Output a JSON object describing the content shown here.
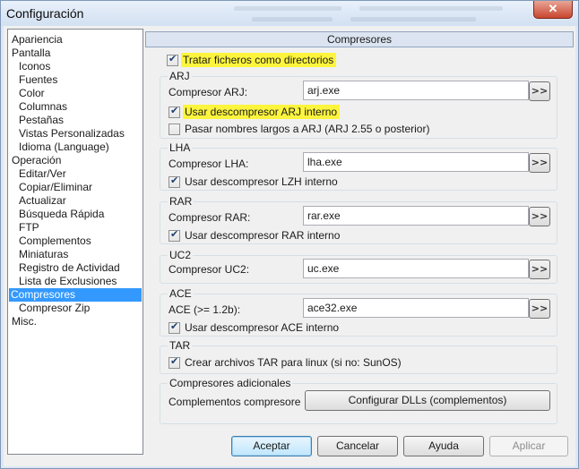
{
  "window": {
    "title": "Configuración",
    "close_label": "✕"
  },
  "tree": {
    "items": [
      {
        "label": "Apariencia",
        "level": 0
      },
      {
        "label": "Pantalla",
        "level": 0
      },
      {
        "label": "Iconos",
        "level": 1
      },
      {
        "label": "Fuentes",
        "level": 1
      },
      {
        "label": "Color",
        "level": 1
      },
      {
        "label": "Columnas",
        "level": 1
      },
      {
        "label": "Pestañas",
        "level": 1
      },
      {
        "label": "Vistas Personalizadas",
        "level": 1
      },
      {
        "label": "Idioma (Language)",
        "level": 1
      },
      {
        "label": "Operación",
        "level": 0
      },
      {
        "label": "Editar/Ver",
        "level": 1
      },
      {
        "label": "Copiar/Eliminar",
        "level": 1
      },
      {
        "label": "Actualizar",
        "level": 1
      },
      {
        "label": "Búsqueda Rápida",
        "level": 1
      },
      {
        "label": "FTP",
        "level": 1
      },
      {
        "label": "Complementos",
        "level": 1
      },
      {
        "label": "Miniaturas",
        "level": 1
      },
      {
        "label": "Registro de Actividad",
        "level": 1
      },
      {
        "label": "Lista de Exclusiones",
        "level": 1
      },
      {
        "label": "Compresores",
        "level": 0,
        "selected": true
      },
      {
        "label": "Compresor Zip",
        "level": 1
      },
      {
        "label": "Misc.",
        "level": 0
      }
    ]
  },
  "panel": {
    "header": "Compresores",
    "treat_as_dirs": {
      "label": "Tratar ficheros como directorios",
      "checked": true
    },
    "arj": {
      "title": "ARJ",
      "compressor_label": "Compresor ARJ:",
      "compressor_value": "arj.exe",
      "internal": {
        "label": "Usar descompresor ARJ interno",
        "checked": true
      },
      "long_names": {
        "label": "Pasar nombres largos a ARJ (ARJ 2.55 o posterior)",
        "checked": false
      }
    },
    "lha": {
      "title": "LHA",
      "compressor_label": "Compresor LHA:",
      "compressor_value": "lha.exe",
      "internal": {
        "label": "Usar descompresor LZH interno",
        "checked": true
      }
    },
    "rar": {
      "title": "RAR",
      "compressor_label": "Compresor RAR:",
      "compressor_value": "rar.exe",
      "internal": {
        "label": "Usar descompresor RAR interno",
        "checked": true
      }
    },
    "uc2": {
      "title": "UC2",
      "compressor_label": "Compresor UC2:",
      "compressor_value": "uc.exe"
    },
    "ace": {
      "title": "ACE",
      "compressor_label": "ACE (>= 1.2b):",
      "compressor_value": "ace32.exe",
      "internal": {
        "label": "Usar descompresor ACE interno",
        "checked": true
      }
    },
    "tar": {
      "title": "TAR",
      "linux": {
        "label": "Crear archivos TAR para linux (si no: SunOS)",
        "checked": true
      }
    },
    "additional": {
      "title": "Compresores adicionales",
      "plugins_label": "Complementos compresore",
      "configure_button": "Configurar DLLs (complementos)"
    },
    "browse_label": ">>"
  },
  "buttons": {
    "ok": "Aceptar",
    "cancel": "Cancelar",
    "help": "Ayuda",
    "apply": "Aplicar"
  },
  "colors": {
    "highlight": "#fdf53d",
    "selection": "#3399ff"
  }
}
